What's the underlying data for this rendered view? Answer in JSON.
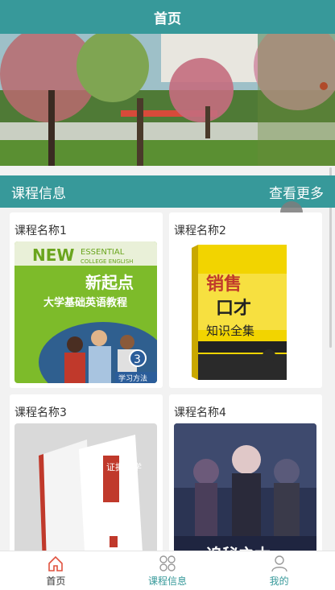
{
  "header": {
    "title": "首页"
  },
  "section": {
    "title": "课程信息",
    "more_label": "查看更多"
  },
  "courses": [
    {
      "name": "课程名称1",
      "cover_text": [
        "NEW",
        "ESSENTIAL",
        "COLLEGE ENGLISH",
        "新起点",
        "大学基础英语教程",
        "3",
        "学习方法"
      ]
    },
    {
      "name": "课程名称2",
      "cover_text": [
        "销售",
        "口才",
        "知识全集"
      ]
    },
    {
      "name": "课程名称3",
      "cover_text": [
        "证据法学"
      ]
    },
    {
      "name": "课程名称4",
      "cover_text": [
        "追秘之木"
      ]
    }
  ],
  "bottom_nav": [
    {
      "label": "首页",
      "icon": "home-icon"
    },
    {
      "label": "课程信息",
      "icon": "grid-icon"
    },
    {
      "label": "我的",
      "icon": "user-icon"
    }
  ],
  "colors": {
    "accent": "#37999a",
    "background": "#f2f2f2"
  }
}
